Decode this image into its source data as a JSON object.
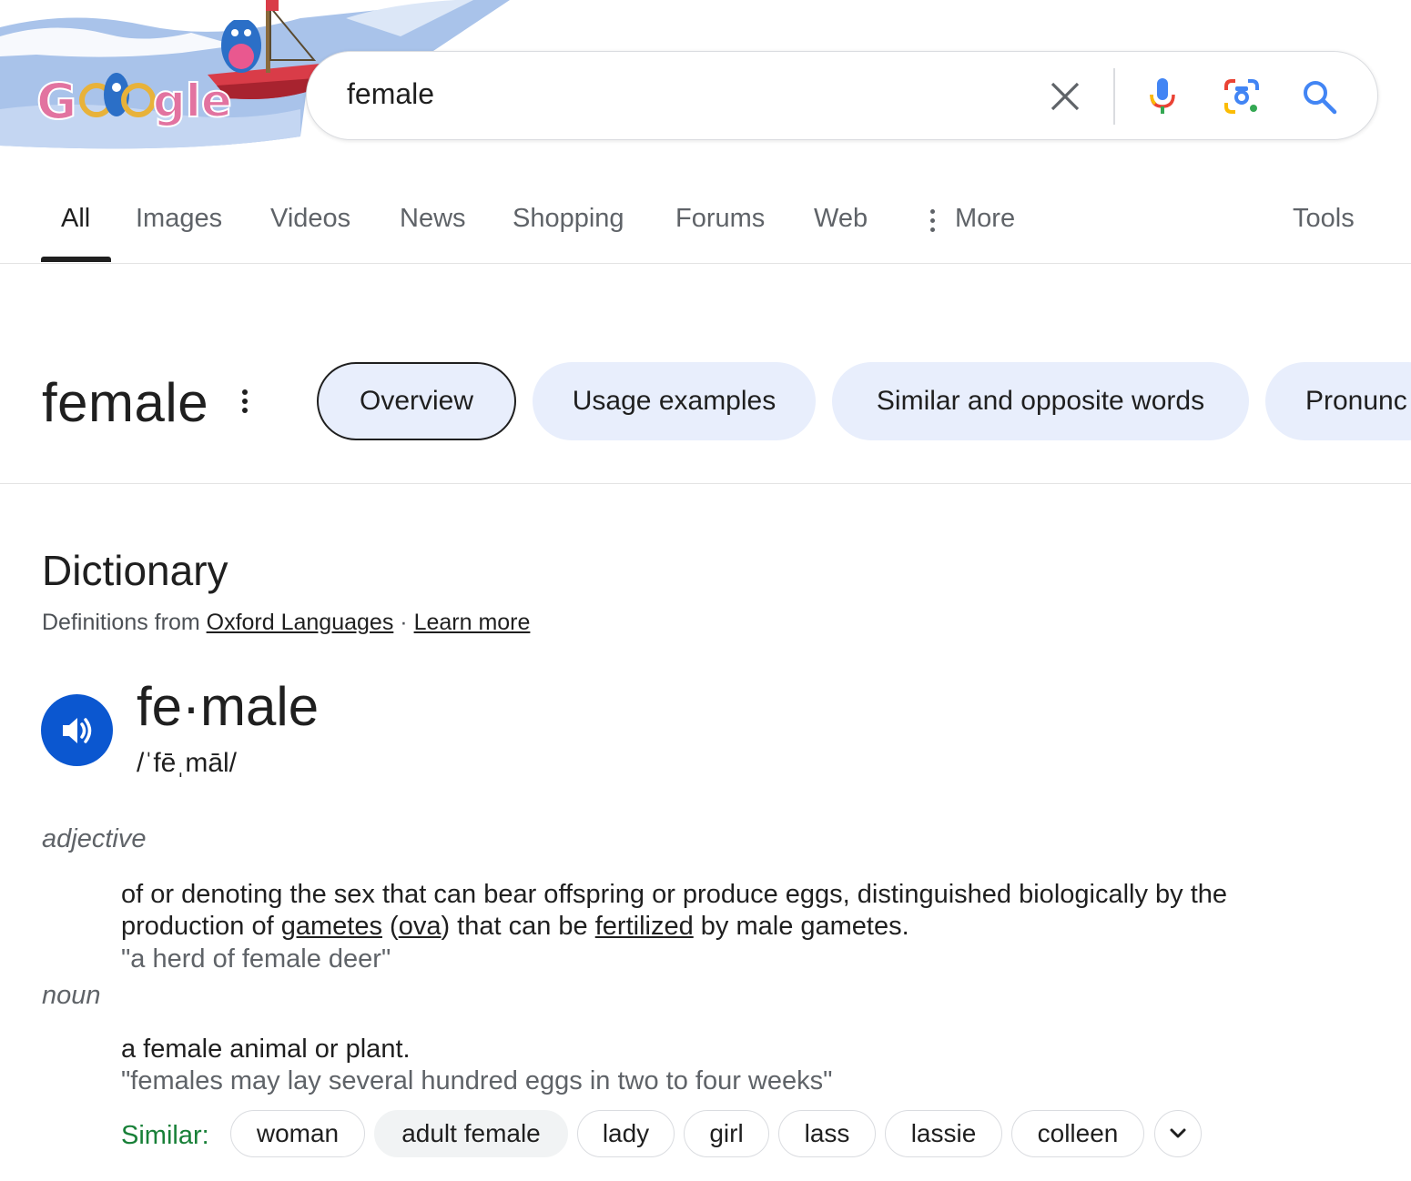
{
  "search": {
    "query": "female"
  },
  "tabs": [
    {
      "label": "All"
    },
    {
      "label": "Images"
    },
    {
      "label": "Videos"
    },
    {
      "label": "News"
    },
    {
      "label": "Shopping"
    },
    {
      "label": "Forums"
    },
    {
      "label": "Web"
    },
    {
      "label": "More"
    },
    {
      "label": "Tools"
    }
  ],
  "term": {
    "title": "female",
    "chips": [
      "Overview",
      "Usage examples",
      "Similar and opposite words",
      "Pronunc"
    ]
  },
  "dictionary": {
    "title": "Dictionary",
    "source_prefix": "Definitions from",
    "source_link": "Oxford Languages",
    "separator": "·",
    "learn_more": "Learn more",
    "word": "fe·male",
    "phonetic": "/ˈfēˌmāl/",
    "senses": [
      {
        "pos": "adjective",
        "def_parts": [
          "of or denoting the sex that can bear offspring or produce eggs, distinguished biologically by the production of ",
          "gametes",
          " (",
          "ova",
          ") that can be ",
          "fertilized",
          " by male gametes."
        ],
        "example": "\"a herd of female deer\""
      },
      {
        "pos": "noun",
        "def": "a female animal or plant.",
        "example": "\"females may lay several hundred eggs in two to four weeks\"",
        "similar_label": "Similar:",
        "similar": [
          "woman",
          "adult female",
          "lady",
          "girl",
          "lass",
          "lassie",
          "colleen"
        ]
      }
    ]
  },
  "icons": {
    "clear": "close-icon",
    "voice": "microphone-icon",
    "lens": "google-lens-icon",
    "search": "search-icon",
    "audio": "speaker-icon",
    "expand": "chevron-down-icon"
  },
  "colors": {
    "accent_blue": "#0b57d0",
    "chip_bg": "#e8eefc",
    "similar_green": "#188038"
  }
}
